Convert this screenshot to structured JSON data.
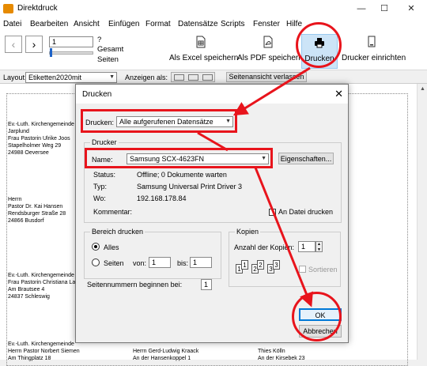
{
  "window": {
    "title": "Direktdruck",
    "btn_min": "—",
    "btn_max": "☐",
    "btn_close": "✕"
  },
  "menu": [
    "Datei",
    "Bearbeiten",
    "Ansicht",
    "Einfügen",
    "Format",
    "Datensätze",
    "Scripts",
    "Fenster",
    "Hilfe"
  ],
  "toolbar": {
    "page_value": "1",
    "total_unknown": "?",
    "total_label": "Gesamt",
    "pages_label": "Seiten",
    "excel_label": "Als Excel speichern",
    "pdf_label": "Als PDF speichern",
    "print_label": "Drucken",
    "printer_setup_label": "Drucker einrichten"
  },
  "layoutbar": {
    "layout_label": "Layout:",
    "layout_value": "Etiketten2020mit",
    "view_label": "Anzeigen als:",
    "exit_preview_label": "Seitenansicht verlassen"
  },
  "addresses": [
    {
      "text": "Ev.-Luth. Kirchengemeinde\nJarplund\nFrau Pastorin Ulrike Joos\nStapelholmer Weg 29\n24988 Oeversee"
    },
    {
      "text": "Herrn\nPastor Dr. Kai Hansen\nRendsburger Straße 28\n24866 Busdorf"
    },
    {
      "text": "Ev.-Luth. Kirchengemeinde\nFrau Pastorin Christiana La\nAm Brautsee 4\n24837 Schleswig"
    },
    {
      "text": "Ev.-Luth. Kirchengemeinde\nHerrn Pastor Norbert Siemen\nAm Thingplatz 18"
    },
    {
      "text": "Herrn Gerd-Ludwig Kraack\nAn der Hansenkoppel 1"
    },
    {
      "text": "Thies Kölln\nAn der Kirsebek 23"
    }
  ],
  "dialog": {
    "title": "Drucken",
    "close": "✕",
    "records_label": "Drucken:",
    "records_value": "Alle aufgerufenen Datensätze",
    "printer_group": "Drucker",
    "name_label": "Name:",
    "printer_name": "Samsung SCX-4623FN",
    "properties_button": "Eigenschaften...",
    "status_label": "Status:",
    "status_value": "Offline; 0 Dokumente warten",
    "type_label": "Typ:",
    "type_value": "Samsung Universal Print Driver 3",
    "where_label": "Wo:",
    "where_value": "192.168.178.84",
    "comment_label": "Kommentar:",
    "print_to_file": "An Datei drucken",
    "range_group": "Bereich drucken",
    "all_label": "Alles",
    "pages_label": "Seiten",
    "from_label": "von:",
    "from_value": "1",
    "to_label": "bis:",
    "to_value": "1",
    "start_page_label": "Seitennummern beginnen bei:",
    "start_page_value": "1",
    "copies_group": "Kopien",
    "copies_label": "Anzahl der Kopien:",
    "copies_value": "1",
    "collate_label": "Sortieren",
    "ok": "OK",
    "cancel": "Abbrechen"
  },
  "colors": {
    "highlight_red": "#e8141c",
    "selected_toolbar": "#cce4f7"
  }
}
